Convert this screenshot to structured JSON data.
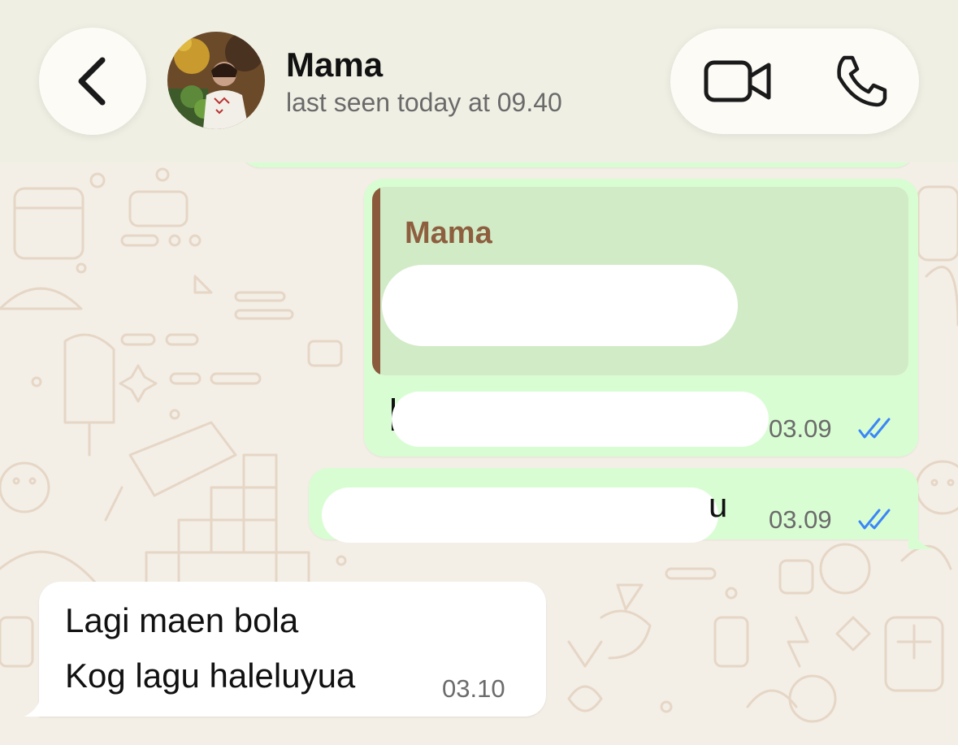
{
  "chat": {
    "contact_name": "Mama",
    "status": "last seen today at 09.40"
  },
  "icons": {
    "back": "chevron-left-icon",
    "video": "video-camera-icon",
    "call": "phone-icon",
    "read": "double-check-icon"
  },
  "colors": {
    "outgoing_bubble": "#d9fdd3",
    "incoming_bubble": "#ffffff",
    "quote_bar": "#8b5a3c",
    "read_ticks": "#3b86f7",
    "wallpaper": "#f3efe6"
  },
  "messages": [
    {
      "direction": "outgoing",
      "quote_author": "Mama",
      "text_visible_fragment": "",
      "time": "03.09",
      "status": "read"
    },
    {
      "direction": "outgoing",
      "text_visible_fragment": "u",
      "time": "03.09",
      "status": "read"
    },
    {
      "direction": "incoming",
      "lines": [
        "Lagi maen bola",
        "Kog lagu haleluyua"
      ],
      "time": "03.10"
    }
  ]
}
